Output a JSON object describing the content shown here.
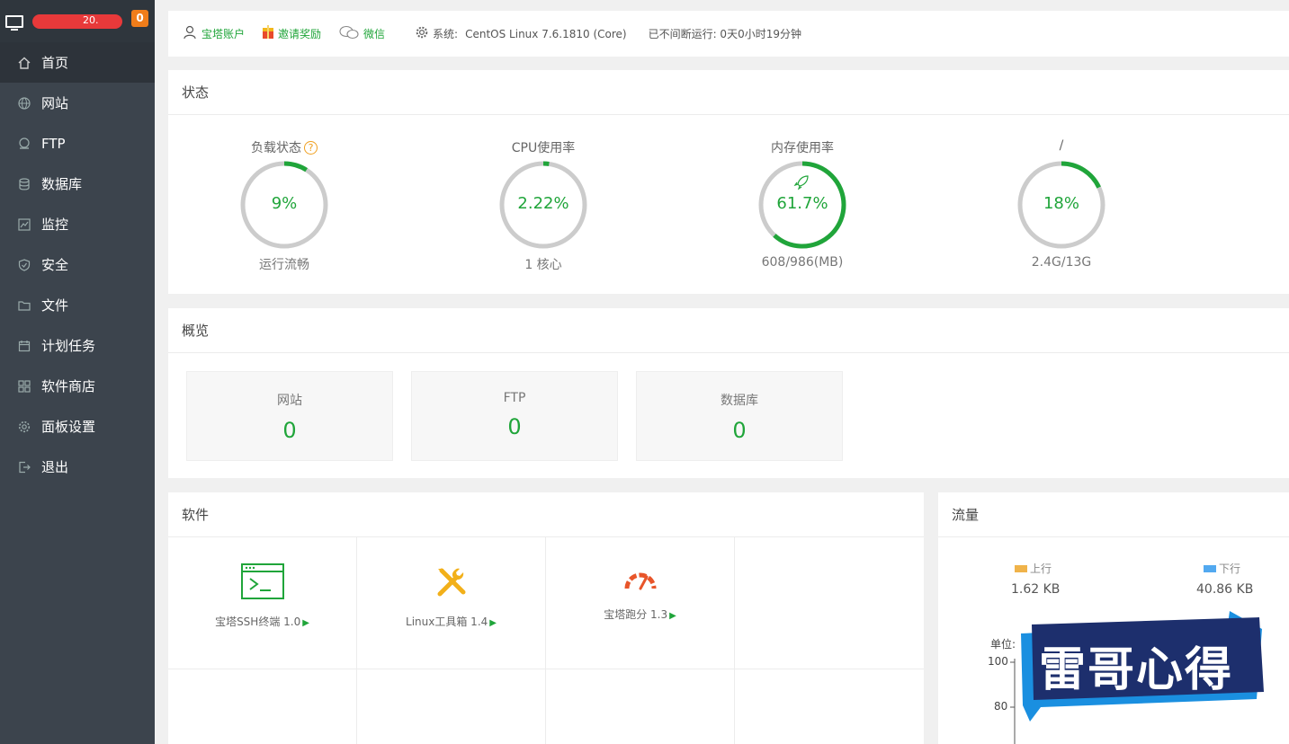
{
  "sidebar": {
    "server_ip_visible": "20.",
    "badge": "0",
    "items": [
      {
        "label": "首页",
        "icon": "home-icon",
        "active": true
      },
      {
        "label": "网站",
        "icon": "globe-icon"
      },
      {
        "label": "FTP",
        "icon": "ftp-icon"
      },
      {
        "label": "数据库",
        "icon": "database-icon"
      },
      {
        "label": "监控",
        "icon": "monitor-icon"
      },
      {
        "label": "安全",
        "icon": "shield-icon"
      },
      {
        "label": "文件",
        "icon": "folder-icon"
      },
      {
        "label": "计划任务",
        "icon": "calendar-icon"
      },
      {
        "label": "软件商店",
        "icon": "apps-icon"
      },
      {
        "label": "面板设置",
        "icon": "gear-icon"
      },
      {
        "label": "退出",
        "icon": "logout-icon"
      }
    ],
    "add_label": "+"
  },
  "infobar": {
    "account": "宝塔账户",
    "invite": "邀请奖励",
    "wechat": "微信",
    "system_label": "系统:",
    "system_value": "CentOS Linux 7.6.1810 (Core)",
    "uptime": "已不间断运行: 0天0小时19分钟"
  },
  "status": {
    "title": "状态",
    "gauges": [
      {
        "label": "负载状态",
        "value": "9%",
        "percent": 9,
        "sub": "运行流畅"
      },
      {
        "label": "CPU使用率",
        "value": "2.22%",
        "percent": 2.22,
        "sub": "1 核心"
      },
      {
        "label": "内存使用率",
        "value": "61.7%",
        "percent": 61.7,
        "sub": "608/986(MB)"
      },
      {
        "label": "/",
        "value": "18%",
        "percent": 18,
        "sub": "2.4G/13G"
      }
    ]
  },
  "overview": {
    "title": "概览",
    "cards": [
      {
        "label": "网站",
        "value": "0"
      },
      {
        "label": "FTP",
        "value": "0"
      },
      {
        "label": "数据库",
        "value": "0"
      }
    ]
  },
  "software": {
    "title": "软件",
    "items": [
      {
        "name": "宝塔SSH终端 1.0",
        "icon": "terminal-icon"
      },
      {
        "name": "Linux工具箱 1.4",
        "icon": "tools-icon"
      },
      {
        "name": "宝塔跑分 1.3",
        "icon": "speedometer-icon"
      }
    ]
  },
  "traffic": {
    "title": "流量",
    "up_label": "上行",
    "up_value": "1.62 KB",
    "down_label": "下行",
    "down_value": "40.86 KB",
    "unit_label": "单位:",
    "y_ticks": [
      "100",
      "80"
    ],
    "up_color": "#f0b34a",
    "down_color": "#52a9f0"
  },
  "watermark": {
    "text": "雷哥心得"
  },
  "colors": {
    "accent": "#20a53a",
    "sidebar": "#3c444d"
  }
}
